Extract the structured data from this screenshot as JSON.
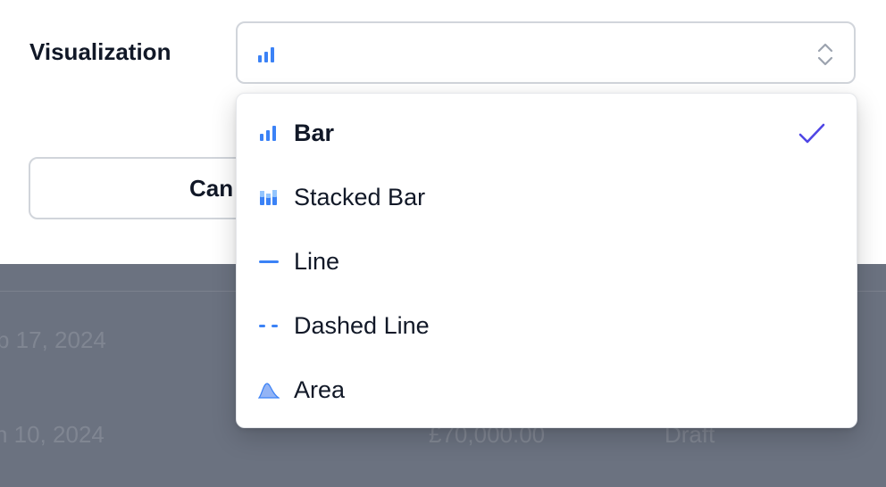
{
  "field": {
    "label": "Visualization"
  },
  "select": {
    "selected_icon": "bar-chart-icon",
    "chevron_icon": "updown-chevrons-icon"
  },
  "cancel_button": {
    "label": "Can"
  },
  "dropdown": {
    "options": [
      {
        "label": "Bar",
        "icon": "bar-chart-icon",
        "selected": true
      },
      {
        "label": "Stacked Bar",
        "icon": "stacked-bar-icon",
        "selected": false
      },
      {
        "label": "Line",
        "icon": "line-icon",
        "selected": false
      },
      {
        "label": "Dashed Line",
        "icon": "dashed-line-icon",
        "selected": false
      },
      {
        "label": "Area",
        "icon": "area-icon",
        "selected": false
      }
    ],
    "check_icon": "check-icon"
  },
  "background_table": {
    "rows": [
      {
        "date": "b 17, 2024"
      },
      {
        "date": "n 10, 2024",
        "amount": "£70,000.00",
        "status": "Draft"
      }
    ]
  },
  "colors": {
    "accent": "#3b82f6",
    "check": "#4f46e5",
    "backdrop": "#6b7280"
  }
}
